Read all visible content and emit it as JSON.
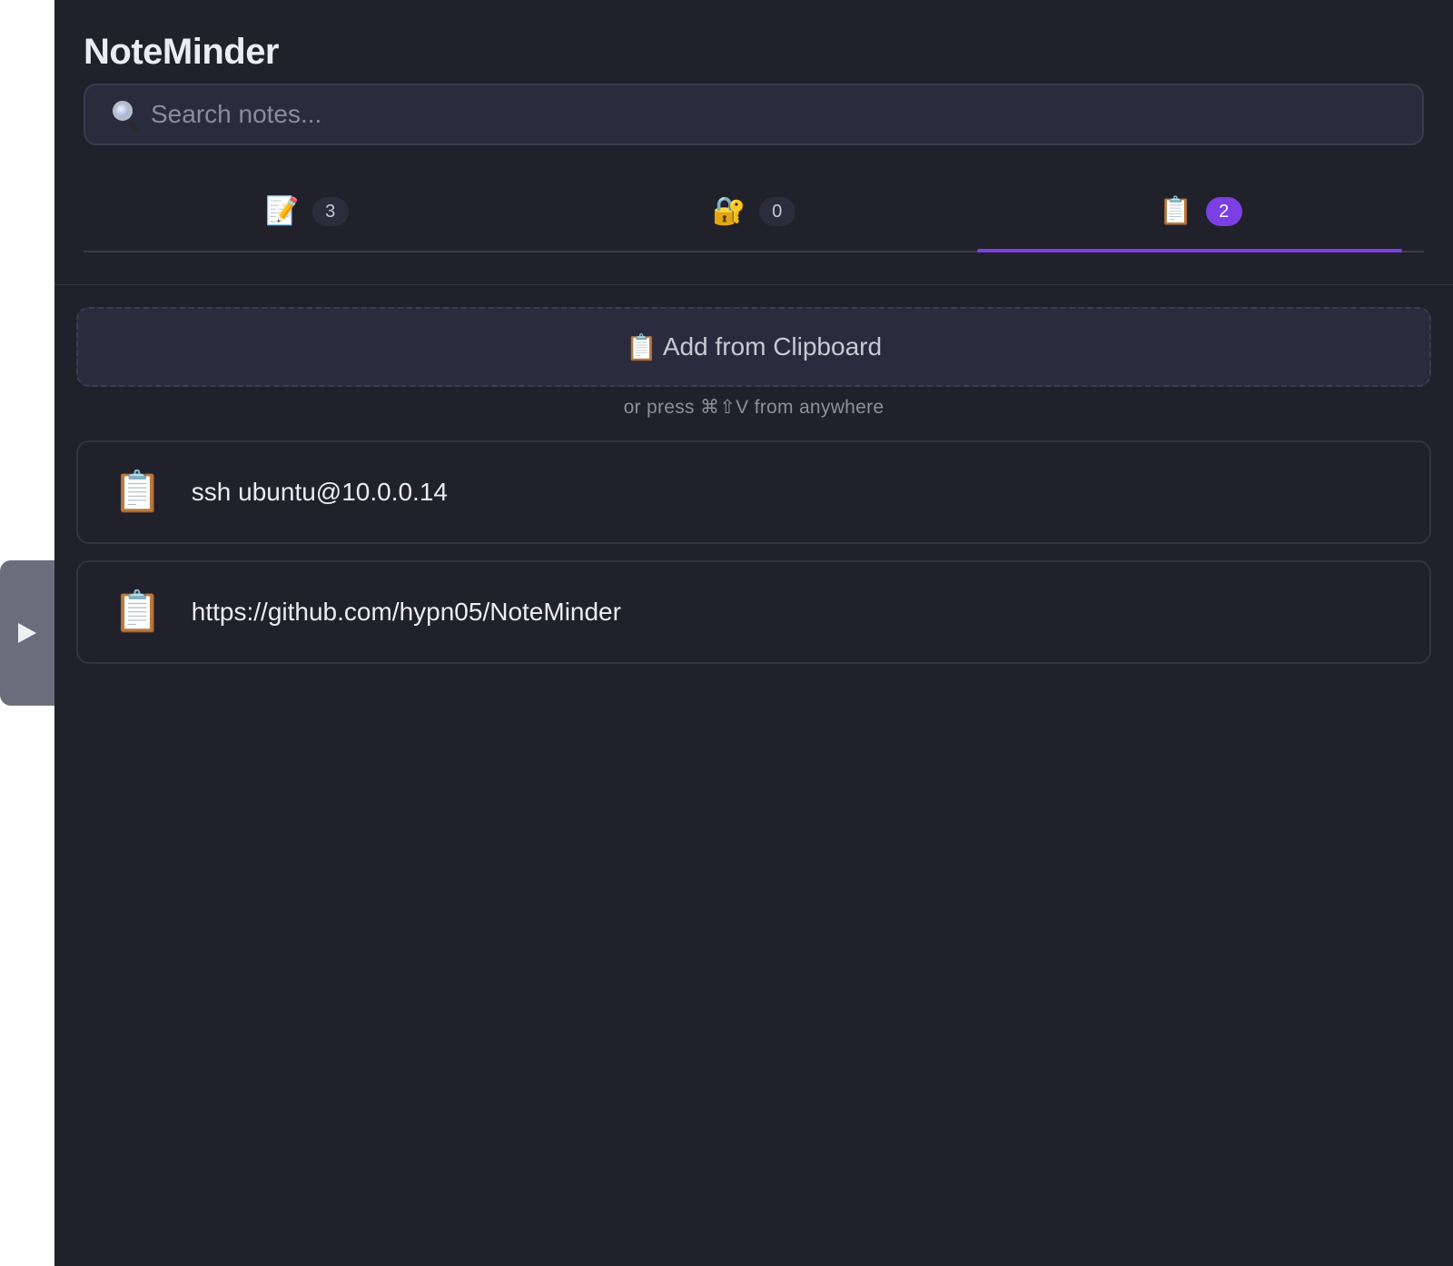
{
  "app": {
    "title": "NoteMinder"
  },
  "search": {
    "placeholder": "Search notes...",
    "value": ""
  },
  "tabs": [
    {
      "icon": "memo-icon",
      "glyph": "📝",
      "count": "3",
      "active": false
    },
    {
      "icon": "lock-key-icon",
      "glyph": "🔐",
      "count": "0",
      "active": false
    },
    {
      "icon": "clipboard-icon",
      "glyph": "📋",
      "count": "2",
      "active": true
    }
  ],
  "clipboard": {
    "add_icon": "📋",
    "add_label": "Add from Clipboard",
    "hint": "or press ⌘⇧V from anywhere",
    "items": [
      {
        "icon": "📋",
        "text": "ssh ubuntu@10.0.0.14"
      },
      {
        "icon": "📋",
        "text": "https://github.com/hypn05/NoteMinder"
      }
    ]
  },
  "colors": {
    "background": "#20212a",
    "accent": "#7b3fe4",
    "handle": "#6c6d7b"
  }
}
